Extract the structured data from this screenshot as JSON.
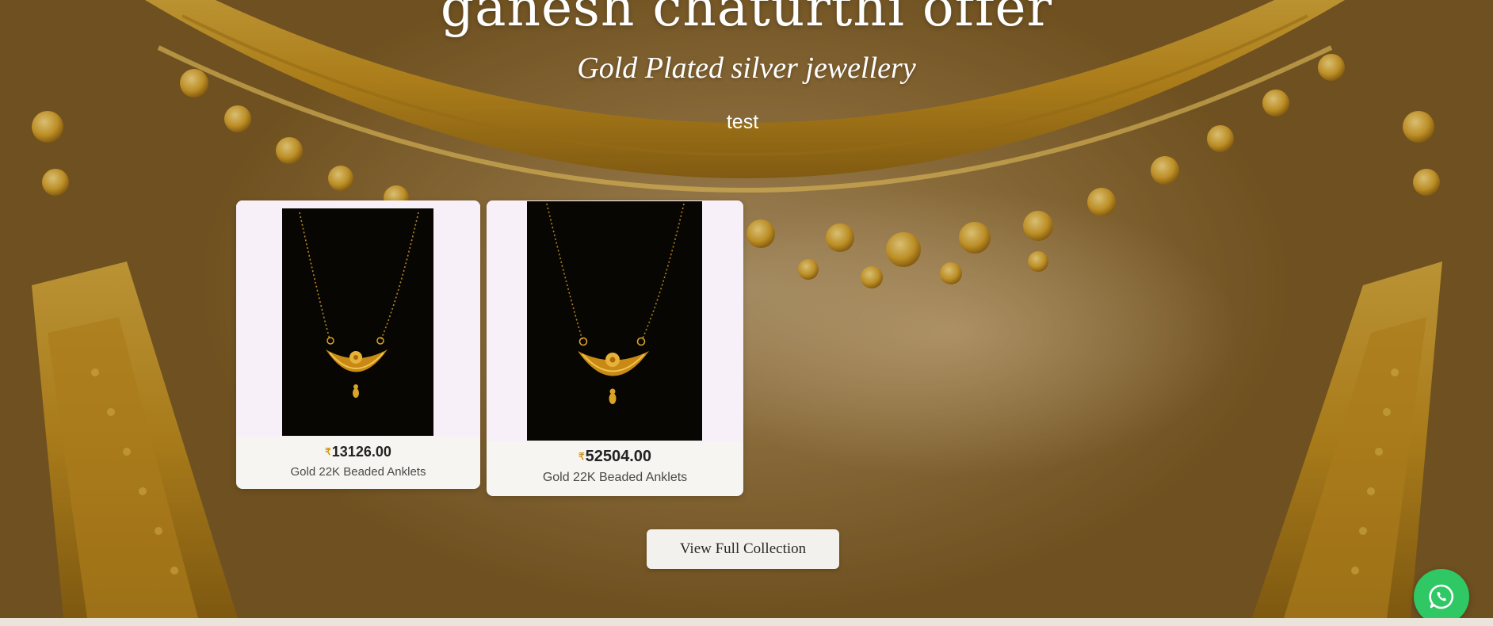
{
  "hero": {
    "title": "ganesh chaturthi offer",
    "subtitle": "Gold Plated silver jewellery",
    "tagline": "test",
    "background_image": "gold-necklace-closeup"
  },
  "products": [
    {
      "price_symbol": "₹",
      "price": "13126.00",
      "name": "Gold 22K Beaded Anklets",
      "image": "gold-mangalsutra-pendant-on-black"
    },
    {
      "price_symbol": "₹",
      "price": "52504.00",
      "name": "Gold 22K Beaded Anklets",
      "image": "gold-mangalsutra-pendant-on-black"
    }
  ],
  "cta": {
    "view_collection_label": "View Full Collection"
  },
  "floating": {
    "whatsapp_icon": "whatsapp-icon"
  },
  "colors": {
    "accent_gold": "#d19a1c",
    "whatsapp_green": "#2fc864",
    "button_bg": "#f3f1ee"
  }
}
